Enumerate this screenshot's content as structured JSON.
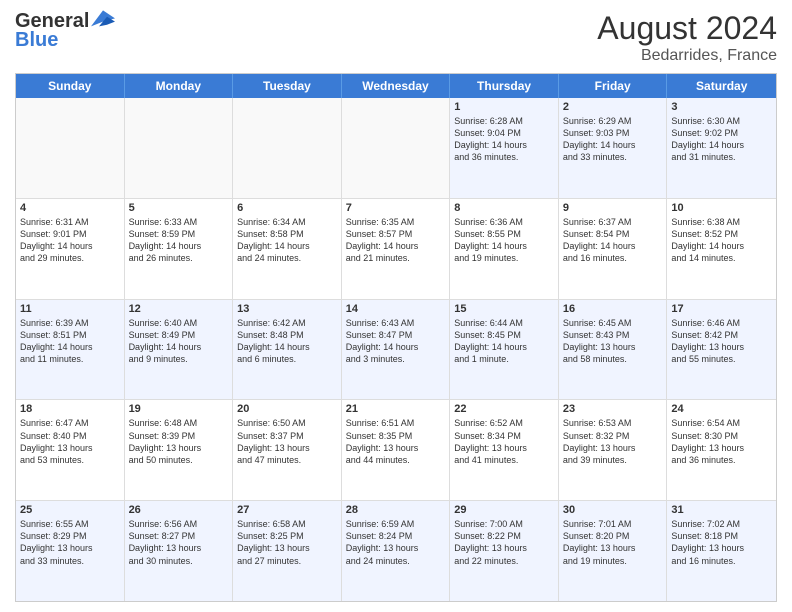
{
  "header": {
    "logo_general": "General",
    "logo_blue": "Blue",
    "month_year": "August 2024",
    "location": "Bedarrides, France"
  },
  "weekdays": [
    "Sunday",
    "Monday",
    "Tuesday",
    "Wednesday",
    "Thursday",
    "Friday",
    "Saturday"
  ],
  "rows": [
    [
      {
        "day": "",
        "info": ""
      },
      {
        "day": "",
        "info": ""
      },
      {
        "day": "",
        "info": ""
      },
      {
        "day": "",
        "info": ""
      },
      {
        "day": "1",
        "info": "Sunrise: 6:28 AM\nSunset: 9:04 PM\nDaylight: 14 hours\nand 36 minutes."
      },
      {
        "day": "2",
        "info": "Sunrise: 6:29 AM\nSunset: 9:03 PM\nDaylight: 14 hours\nand 33 minutes."
      },
      {
        "day": "3",
        "info": "Sunrise: 6:30 AM\nSunset: 9:02 PM\nDaylight: 14 hours\nand 31 minutes."
      }
    ],
    [
      {
        "day": "4",
        "info": "Sunrise: 6:31 AM\nSunset: 9:01 PM\nDaylight: 14 hours\nand 29 minutes."
      },
      {
        "day": "5",
        "info": "Sunrise: 6:33 AM\nSunset: 8:59 PM\nDaylight: 14 hours\nand 26 minutes."
      },
      {
        "day": "6",
        "info": "Sunrise: 6:34 AM\nSunset: 8:58 PM\nDaylight: 14 hours\nand 24 minutes."
      },
      {
        "day": "7",
        "info": "Sunrise: 6:35 AM\nSunset: 8:57 PM\nDaylight: 14 hours\nand 21 minutes."
      },
      {
        "day": "8",
        "info": "Sunrise: 6:36 AM\nSunset: 8:55 PM\nDaylight: 14 hours\nand 19 minutes."
      },
      {
        "day": "9",
        "info": "Sunrise: 6:37 AM\nSunset: 8:54 PM\nDaylight: 14 hours\nand 16 minutes."
      },
      {
        "day": "10",
        "info": "Sunrise: 6:38 AM\nSunset: 8:52 PM\nDaylight: 14 hours\nand 14 minutes."
      }
    ],
    [
      {
        "day": "11",
        "info": "Sunrise: 6:39 AM\nSunset: 8:51 PM\nDaylight: 14 hours\nand 11 minutes."
      },
      {
        "day": "12",
        "info": "Sunrise: 6:40 AM\nSunset: 8:49 PM\nDaylight: 14 hours\nand 9 minutes."
      },
      {
        "day": "13",
        "info": "Sunrise: 6:42 AM\nSunset: 8:48 PM\nDaylight: 14 hours\nand 6 minutes."
      },
      {
        "day": "14",
        "info": "Sunrise: 6:43 AM\nSunset: 8:47 PM\nDaylight: 14 hours\nand 3 minutes."
      },
      {
        "day": "15",
        "info": "Sunrise: 6:44 AM\nSunset: 8:45 PM\nDaylight: 14 hours\nand 1 minute."
      },
      {
        "day": "16",
        "info": "Sunrise: 6:45 AM\nSunset: 8:43 PM\nDaylight: 13 hours\nand 58 minutes."
      },
      {
        "day": "17",
        "info": "Sunrise: 6:46 AM\nSunset: 8:42 PM\nDaylight: 13 hours\nand 55 minutes."
      }
    ],
    [
      {
        "day": "18",
        "info": "Sunrise: 6:47 AM\nSunset: 8:40 PM\nDaylight: 13 hours\nand 53 minutes."
      },
      {
        "day": "19",
        "info": "Sunrise: 6:48 AM\nSunset: 8:39 PM\nDaylight: 13 hours\nand 50 minutes."
      },
      {
        "day": "20",
        "info": "Sunrise: 6:50 AM\nSunset: 8:37 PM\nDaylight: 13 hours\nand 47 minutes."
      },
      {
        "day": "21",
        "info": "Sunrise: 6:51 AM\nSunset: 8:35 PM\nDaylight: 13 hours\nand 44 minutes."
      },
      {
        "day": "22",
        "info": "Sunrise: 6:52 AM\nSunset: 8:34 PM\nDaylight: 13 hours\nand 41 minutes."
      },
      {
        "day": "23",
        "info": "Sunrise: 6:53 AM\nSunset: 8:32 PM\nDaylight: 13 hours\nand 39 minutes."
      },
      {
        "day": "24",
        "info": "Sunrise: 6:54 AM\nSunset: 8:30 PM\nDaylight: 13 hours\nand 36 minutes."
      }
    ],
    [
      {
        "day": "25",
        "info": "Sunrise: 6:55 AM\nSunset: 8:29 PM\nDaylight: 13 hours\nand 33 minutes."
      },
      {
        "day": "26",
        "info": "Sunrise: 6:56 AM\nSunset: 8:27 PM\nDaylight: 13 hours\nand 30 minutes."
      },
      {
        "day": "27",
        "info": "Sunrise: 6:58 AM\nSunset: 8:25 PM\nDaylight: 13 hours\nand 27 minutes."
      },
      {
        "day": "28",
        "info": "Sunrise: 6:59 AM\nSunset: 8:24 PM\nDaylight: 13 hours\nand 24 minutes."
      },
      {
        "day": "29",
        "info": "Sunrise: 7:00 AM\nSunset: 8:22 PM\nDaylight: 13 hours\nand 22 minutes."
      },
      {
        "day": "30",
        "info": "Sunrise: 7:01 AM\nSunset: 8:20 PM\nDaylight: 13 hours\nand 19 minutes."
      },
      {
        "day": "31",
        "info": "Sunrise: 7:02 AM\nSunset: 8:18 PM\nDaylight: 13 hours\nand 16 minutes."
      }
    ]
  ]
}
